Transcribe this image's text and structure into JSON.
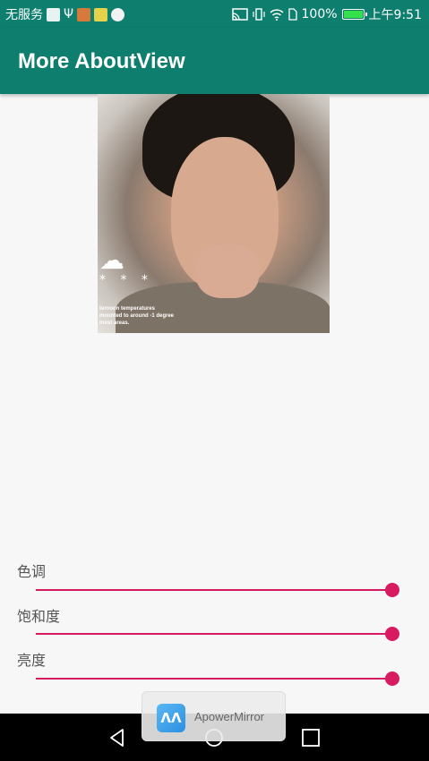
{
  "status_bar": {
    "carrier": "无服务",
    "battery": "100%",
    "battery_level": 1.0,
    "time": "上午9:51",
    "icons": [
      "mountain-icon",
      "usb-icon",
      "app-icon",
      "maps-icon",
      "weibo-icon",
      "cast-icon",
      "vibrate-icon",
      "wifi-icon",
      "sim-icon",
      "battery-icon"
    ]
  },
  "app_bar": {
    "title": "More AboutView"
  },
  "photo": {
    "caption_lines": [
      "ternoon temperatures",
      "mounted to around -1 degree",
      "most areas."
    ],
    "cloud_icon": "snow-cloud-icon",
    "stars": "* * *"
  },
  "controls": [
    {
      "label": "色调",
      "value": 1.0
    },
    {
      "label": "饱和度",
      "value": 1.0
    },
    {
      "label": "亮度",
      "value": 1.0
    }
  ],
  "colors": {
    "primary": "#0e7f6e",
    "accent": "#d81b60",
    "background": "#f7f7f7"
  },
  "toast": {
    "text": "ApowerMirror",
    "icon": "apowermirror-icon"
  },
  "nav_bar": {
    "buttons": [
      "back-icon",
      "home-icon",
      "recents-icon"
    ]
  }
}
